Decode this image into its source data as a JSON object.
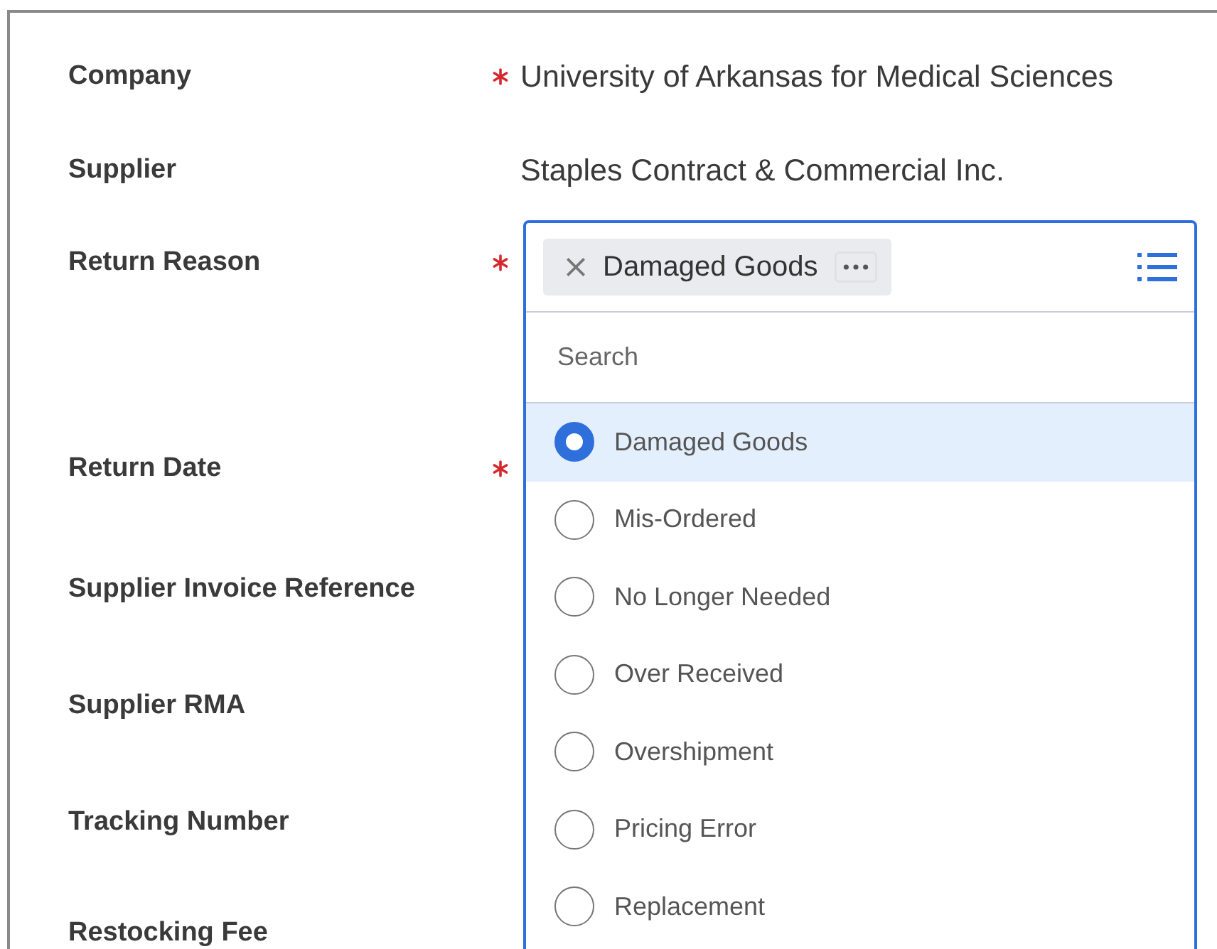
{
  "fields": [
    {
      "label": "Company",
      "required": true,
      "value": "University of Arkansas for Medical Sciences"
    },
    {
      "label": "Supplier",
      "required": false,
      "value": "Staples Contract & Commercial Inc."
    },
    {
      "label": "Return Reason",
      "required": true
    },
    {
      "label": "Return Date",
      "required": true
    },
    {
      "label": "Supplier Invoice Reference",
      "required": false
    },
    {
      "label": "Supplier RMA",
      "required": false
    },
    {
      "label": "Tracking Number",
      "required": false
    },
    {
      "label": "Restocking Fee",
      "required": false
    }
  ],
  "return_reason_dropdown": {
    "chip": "Damaged Goods",
    "search": {
      "placeholder": "Search"
    },
    "options": [
      {
        "label": "Damaged Goods",
        "selected": true
      },
      {
        "label": "Mis-Ordered",
        "selected": false
      },
      {
        "label": "No Longer Needed",
        "selected": false
      },
      {
        "label": "Over Received",
        "selected": false
      },
      {
        "label": "Overshipment",
        "selected": false
      },
      {
        "label": "Pricing Error",
        "selected": false
      },
      {
        "label": "Replacement",
        "selected": false
      }
    ]
  }
}
